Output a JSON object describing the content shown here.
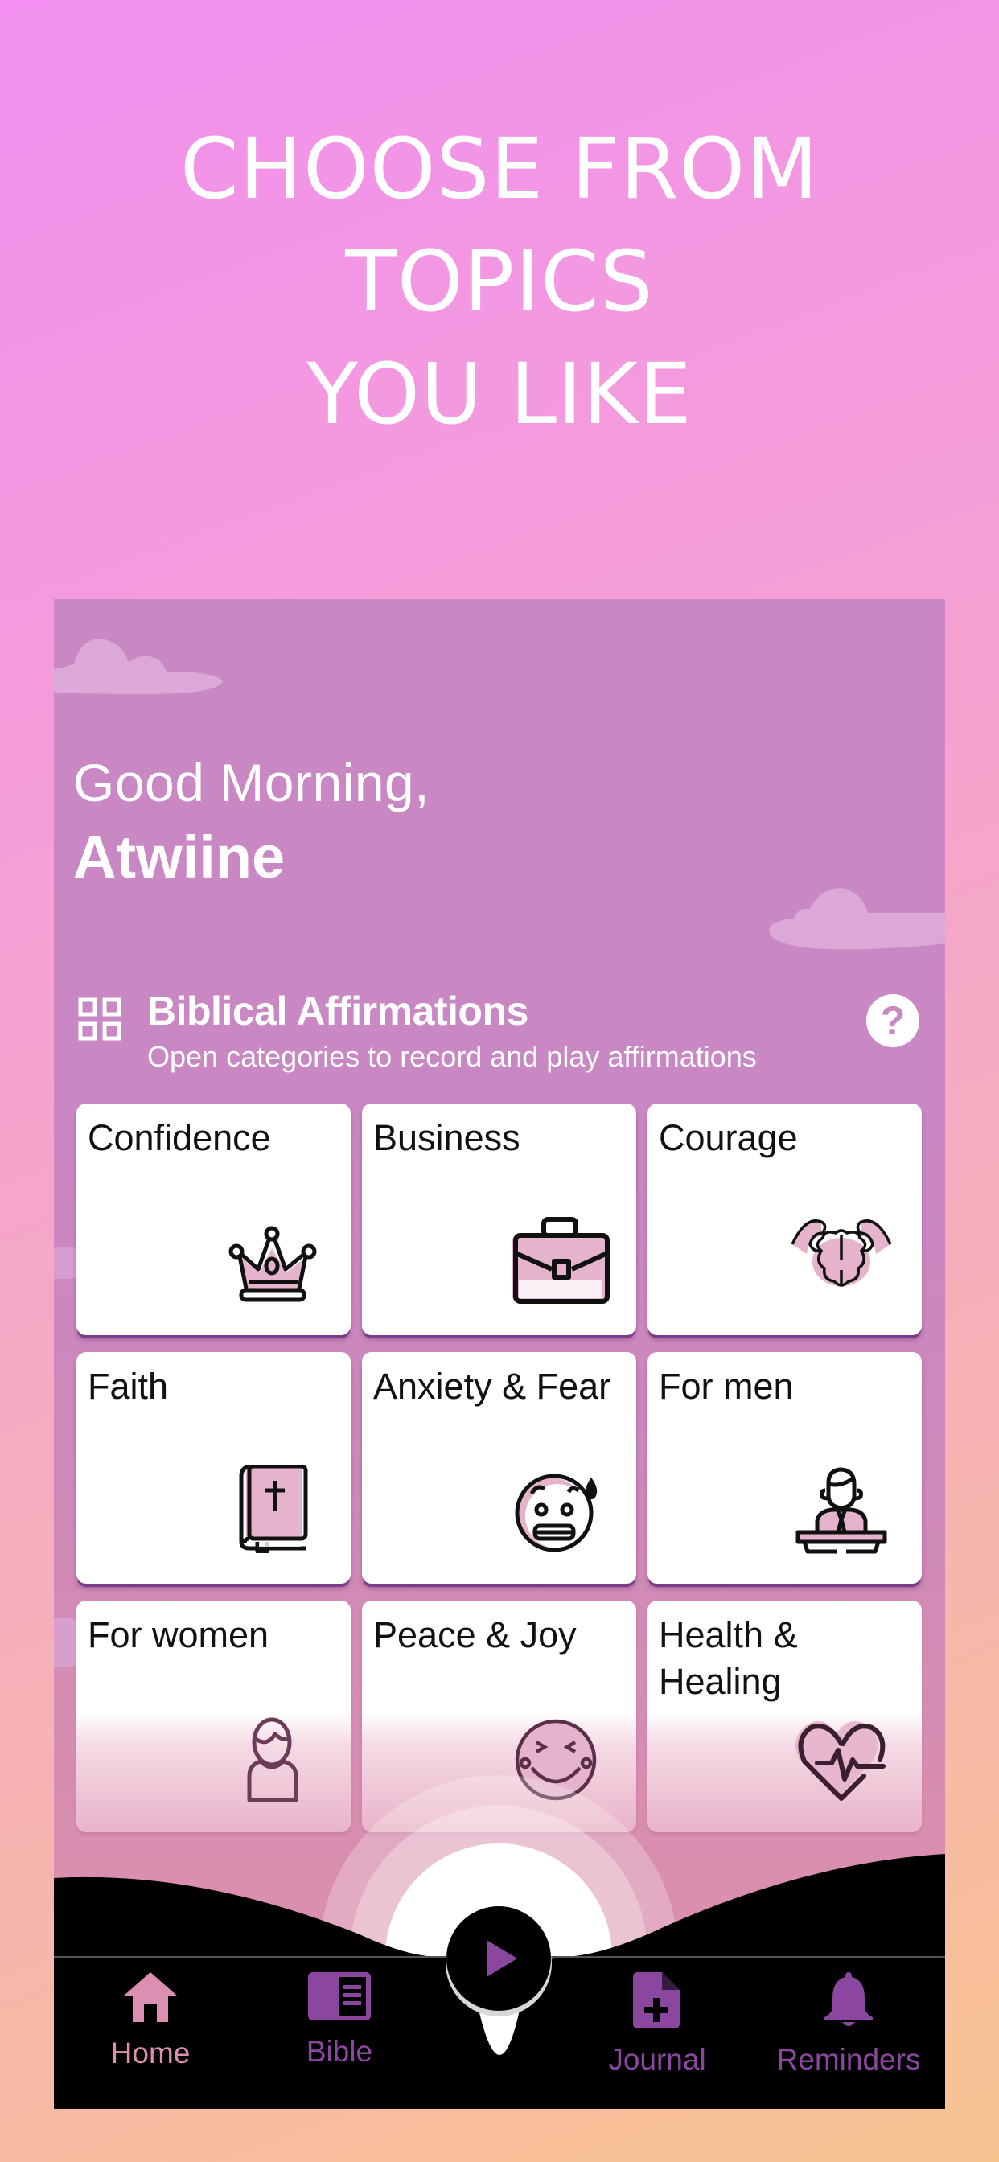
{
  "promo": {
    "headline_lines": [
      "CHOOSE FROM",
      "TOPICS",
      "YOU LIKE"
    ]
  },
  "app": {
    "greeting": "Good Morning,",
    "user_name": "Atwiine",
    "section": {
      "icon": "grid-icon",
      "title": "Biblical Affirmations",
      "subtitle": "Open categories to record and play affirmations",
      "help_icon": "question-mark-icon",
      "help_label": "?"
    },
    "categories": [
      {
        "label": "Confidence",
        "icon": "crown-icon"
      },
      {
        "label": "Business",
        "icon": "briefcase-icon"
      },
      {
        "label": "Courage",
        "icon": "strong-brain-icon"
      },
      {
        "label": "Faith",
        "icon": "bible-icon"
      },
      {
        "label": "Anxiety & Fear",
        "icon": "anxious-face-icon"
      },
      {
        "label": "For men",
        "icon": "man-at-podium-icon"
      },
      {
        "label": "For women",
        "icon": "woman-icon"
      },
      {
        "label": "Peace & Joy",
        "icon": "laughing-face-icon"
      },
      {
        "label": "Health & Healing",
        "icon": "heartbeat-icon"
      }
    ],
    "play_button": {
      "icon": "play-icon"
    },
    "bottom_nav": [
      {
        "label": "Home",
        "icon": "home-icon",
        "active": true
      },
      {
        "label": "Bible",
        "icon": "book-icon",
        "active": false
      },
      {
        "label": "Journal",
        "icon": "add-document-icon",
        "active": false
      },
      {
        "label": "Reminders",
        "icon": "bell-icon",
        "active": false
      }
    ],
    "colors": {
      "screen_bg": "#c987c3",
      "nav_bg": "#000000",
      "nav_active": "#dd8fb2",
      "nav_inactive": "#8b46a0",
      "icon_accent": "#e5b3cb"
    }
  }
}
